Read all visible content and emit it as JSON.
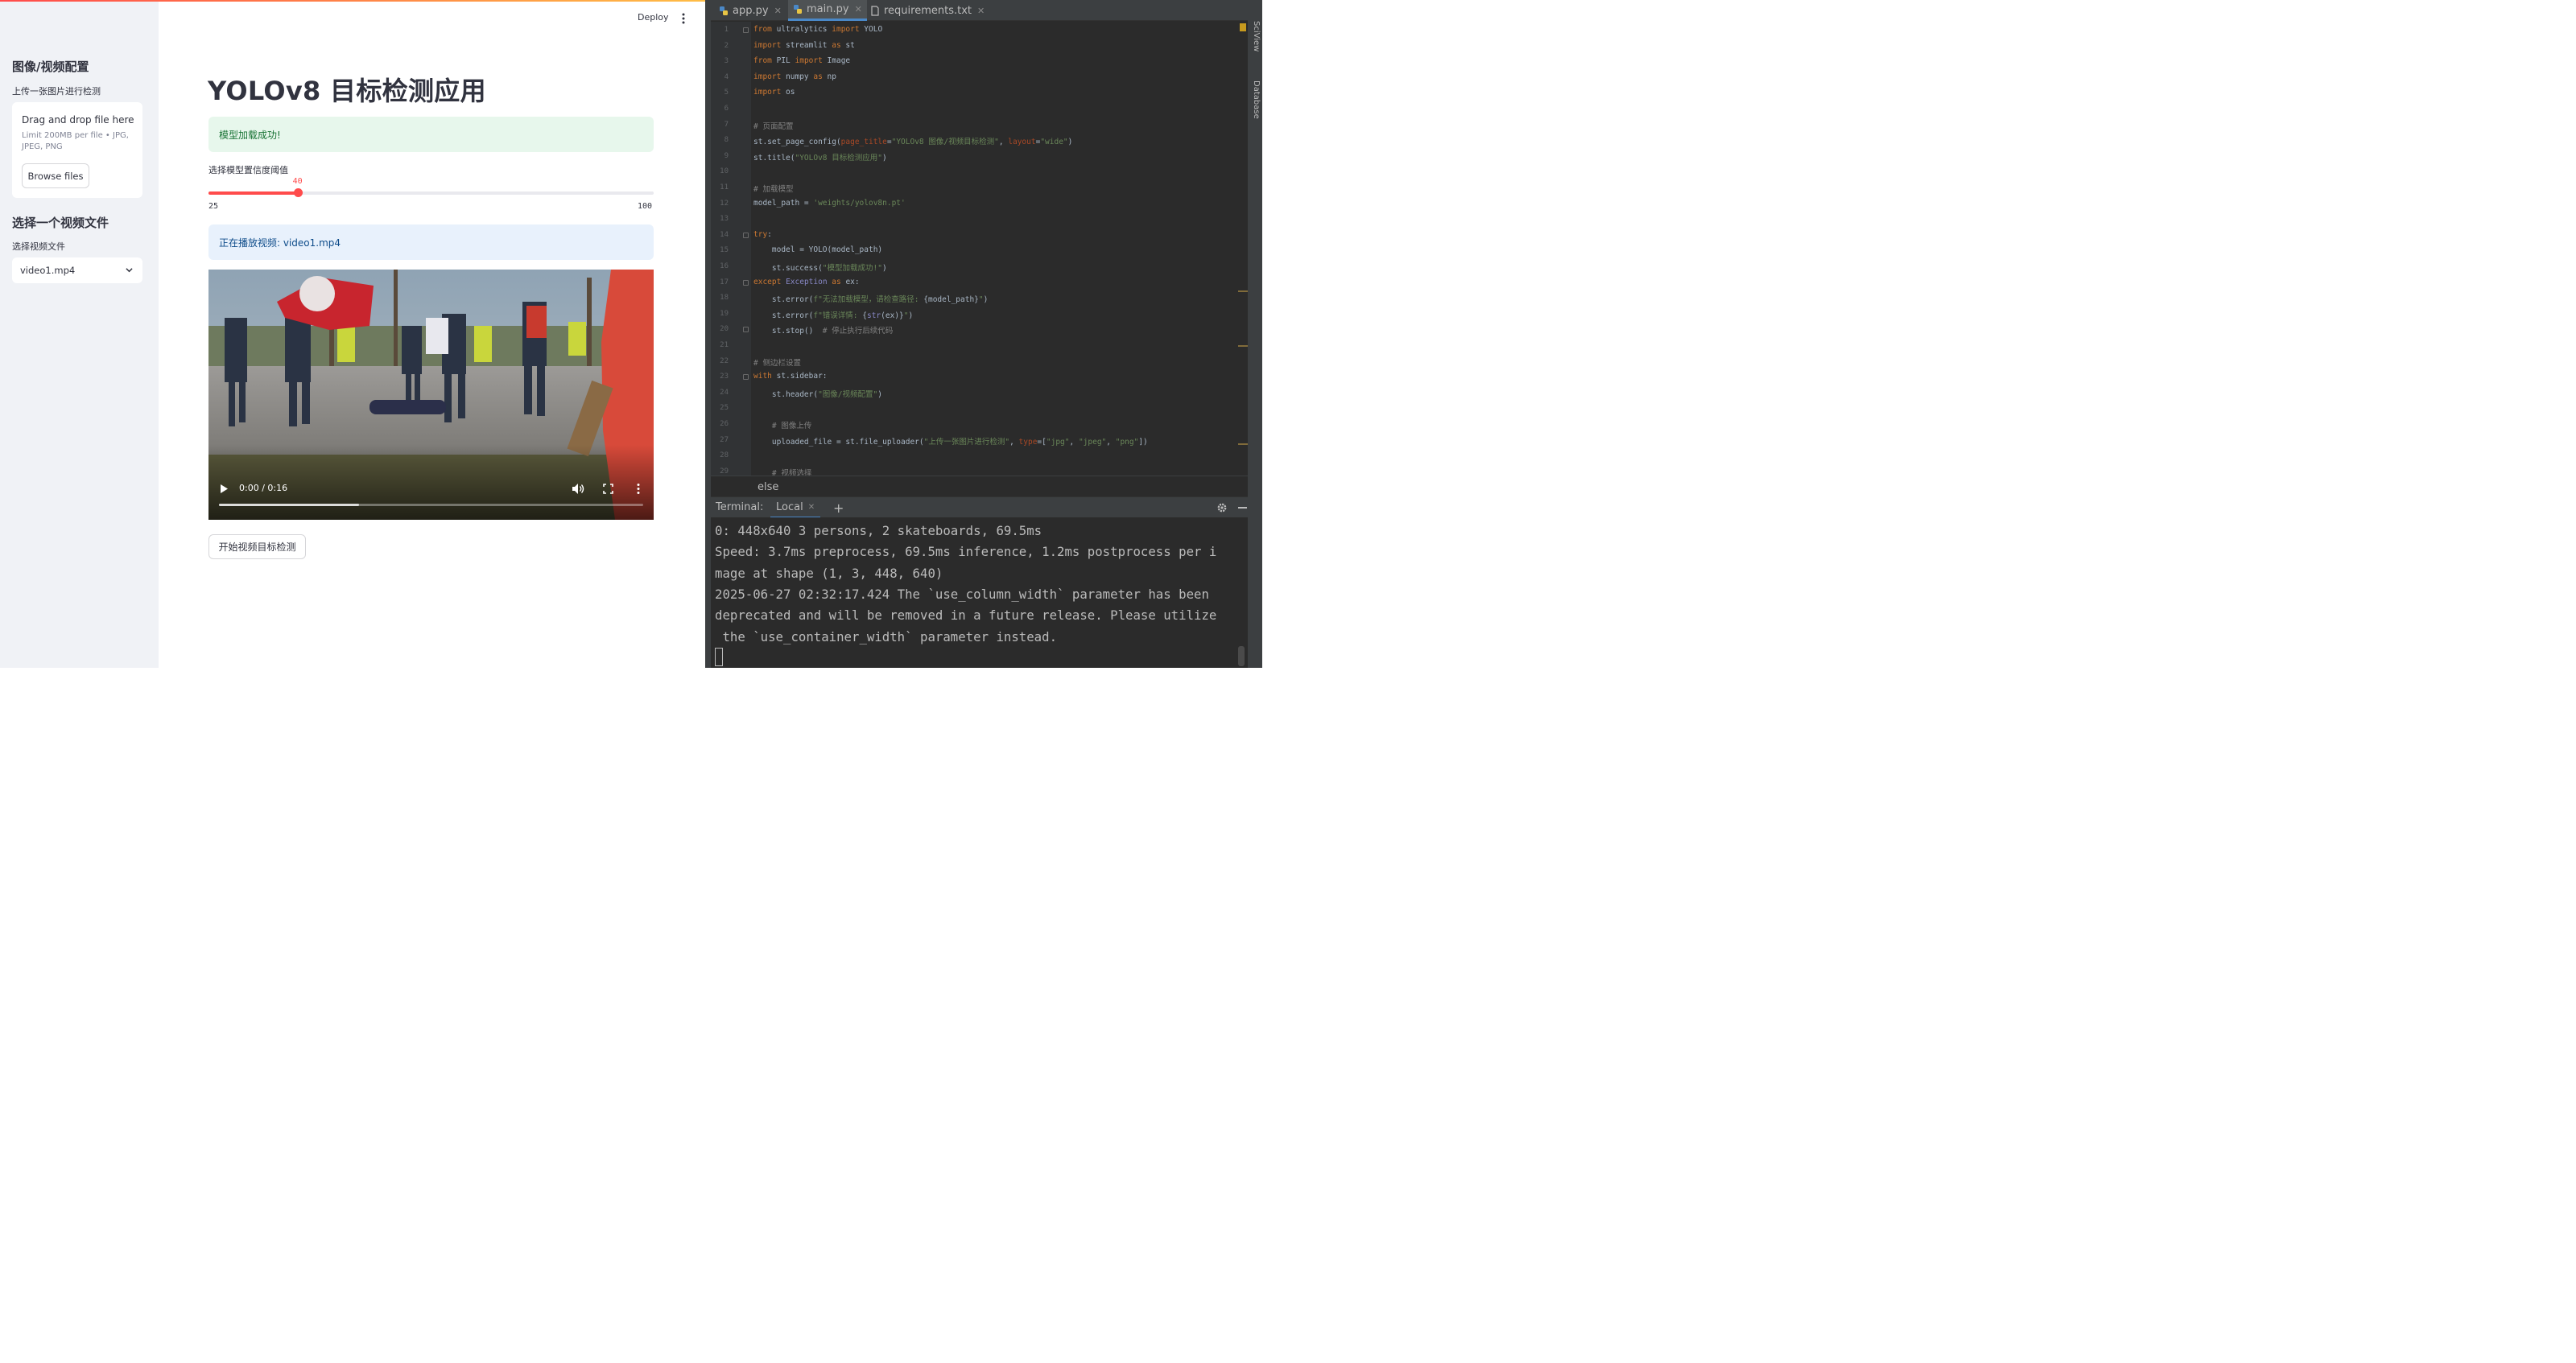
{
  "app": {
    "sidebar": {
      "header1": "图像/视频配置",
      "upload_label": "上传一张图片进行检测",
      "dropzone_title": "Drag and drop file here",
      "dropzone_limit": "Limit 200MB per file • JPG, JPEG, PNG",
      "browse_button": "Browse files",
      "header2": "选择一个视频文件",
      "select_label": "选择视频文件",
      "select_value": "video1.mp4"
    },
    "toolbar": {
      "deploy": "Deploy"
    },
    "main": {
      "title": "YOLOv8 目标检测应用",
      "success_msg": "模型加载成功!",
      "slider_label": "选择模型置信度阈值",
      "slider_value": 40,
      "slider_min": 25,
      "slider_max": 100,
      "info_msg": "正在播放视频: video1.mp4",
      "video_time": "0:00 / 0:16",
      "video_buffered": 0.33,
      "detect_button": "开始视频目标检测"
    }
  },
  "ide": {
    "tabs": [
      {
        "label": "app.py",
        "active": false
      },
      {
        "label": "main.py",
        "active": true
      },
      {
        "label": "requirements.txt",
        "active": false
      }
    ],
    "side_tabs": [
      "SciView",
      "Database"
    ],
    "code_lines": [
      [
        [
          "kw",
          "from"
        ],
        [
          "t",
          " ultralytics "
        ],
        [
          "kw",
          "import"
        ],
        [
          "t",
          " YOLO"
        ]
      ],
      [
        [
          "kw",
          "import"
        ],
        [
          "t",
          " streamlit "
        ],
        [
          "kw",
          "as"
        ],
        [
          "t",
          " st"
        ]
      ],
      [
        [
          "kw",
          "from"
        ],
        [
          "t",
          " PIL "
        ],
        [
          "kw",
          "import"
        ],
        [
          "t",
          " Image"
        ]
      ],
      [
        [
          "kw",
          "import"
        ],
        [
          "t",
          " numpy "
        ],
        [
          "kw",
          "as"
        ],
        [
          "t",
          " np"
        ]
      ],
      [
        [
          "kw",
          "import"
        ],
        [
          "t",
          " os"
        ]
      ],
      [],
      [
        [
          "cm",
          "# 页面配置"
        ]
      ],
      [
        [
          "t",
          "st.set_page_config("
        ],
        [
          "param",
          "page_title"
        ],
        [
          "t",
          "="
        ],
        [
          "str",
          "\"YOLOv8 图像/视频目标检测\""
        ],
        [
          "t",
          ", "
        ],
        [
          "param",
          "layout"
        ],
        [
          "t",
          "="
        ],
        [
          "str",
          "\"wide\""
        ],
        [
          "t",
          ")"
        ]
      ],
      [
        [
          "t",
          "st.title("
        ],
        [
          "str",
          "\"YOLOv8 目标检测应用\""
        ],
        [
          "t",
          ")"
        ]
      ],
      [],
      [
        [
          "cm",
          "# 加载模型"
        ]
      ],
      [
        [
          "t",
          "model_path = "
        ],
        [
          "str",
          "'weights/yolov8n.pt'"
        ]
      ],
      [],
      [
        [
          "kw",
          "try"
        ],
        [
          "t",
          ":"
        ]
      ],
      [
        [
          "t",
          "    model = YOLO(model_path)"
        ]
      ],
      [
        [
          "t",
          "    st.success("
        ],
        [
          "str",
          "\"模型加载成功!\""
        ],
        [
          "t",
          ")"
        ]
      ],
      [
        [
          "kw",
          "except"
        ],
        [
          "t",
          " "
        ],
        [
          "bi",
          "Exception"
        ],
        [
          "t",
          " "
        ],
        [
          "kw",
          "as"
        ],
        [
          "t",
          " ex:"
        ]
      ],
      [
        [
          "t",
          "    st.error("
        ],
        [
          "str",
          "f\"无法加载模型，请检查路径: "
        ],
        [
          "t",
          "{model_path}"
        ],
        [
          "str",
          "\""
        ],
        [
          "t",
          ")"
        ]
      ],
      [
        [
          "t",
          "    st.error("
        ],
        [
          "str",
          "f\"错误详情: "
        ],
        [
          "t",
          "{"
        ],
        [
          "bi",
          "str"
        ],
        [
          "t",
          "(ex)}"
        ],
        [
          "str",
          "\""
        ],
        [
          "t",
          ")"
        ]
      ],
      [
        [
          "t",
          "    st.stop()  "
        ],
        [
          "cm",
          "# 停止执行后续代码"
        ]
      ],
      [],
      [
        [
          "cm",
          "# 侧边栏设置"
        ]
      ],
      [
        [
          "kw",
          "with"
        ],
        [
          "t",
          " st.sidebar:"
        ]
      ],
      [
        [
          "t",
          "    st.header("
        ],
        [
          "str",
          "\"图像/视频配置\""
        ],
        [
          "t",
          ")"
        ]
      ],
      [],
      [
        [
          "cm",
          "    # 图像上传"
        ]
      ],
      [
        [
          "t",
          "    uploaded_file = st.file_uploader("
        ],
        [
          "str",
          "\"上传一张图片进行检测\""
        ],
        [
          "t",
          ", "
        ],
        [
          "param",
          "type"
        ],
        [
          "t",
          "=["
        ],
        [
          "str",
          "\"jpg\""
        ],
        [
          "t",
          ", "
        ],
        [
          "str",
          "\"jpeg\""
        ],
        [
          "t",
          ", "
        ],
        [
          "str",
          "\"png\""
        ],
        [
          "t",
          "])"
        ]
      ],
      [],
      [
        [
          "cm",
          "    # 视频选择"
        ]
      ]
    ],
    "breadcrumb": "else",
    "terminal": {
      "title": "Terminal:",
      "tab": "Local",
      "add": "+",
      "lines": [
        "0: 448x640 3 persons, 2 skateboards, 69.5ms",
        "Speed: 3.7ms preprocess, 69.5ms inference, 1.2ms postprocess per i",
        "mage at shape (1, 3, 448, 640)",
        "2025-06-27 02:32:17.424 The `use_column_width` parameter has been",
        "deprecated and will be removed in a future release. Please utilize",
        " the `use_container_width` parameter instead."
      ]
    }
  }
}
